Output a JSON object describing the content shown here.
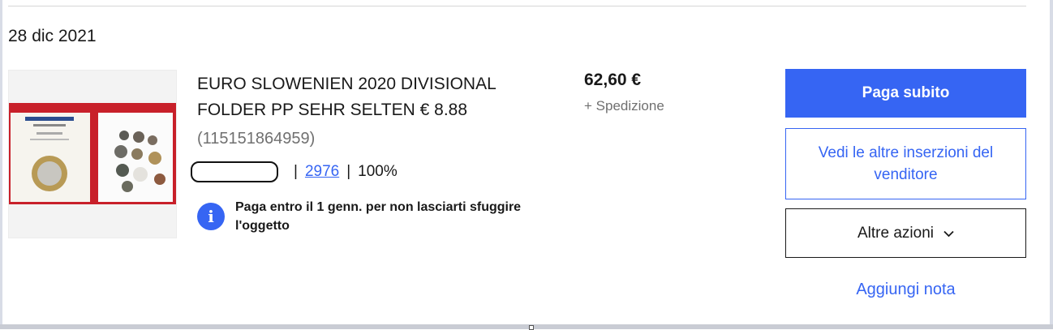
{
  "order": {
    "date": "28 dic 2021"
  },
  "item": {
    "title": "EURO SLOWENIEN 2020 DIVISIONAL FOLDER PP SEHR SELTEN € 8.88",
    "item_number": "(115151864959)",
    "seller": {
      "feedback_count": "2976",
      "feedback_percent": "100%",
      "separator": "|"
    },
    "notice": {
      "icon": "info-icon",
      "icon_glyph": "i",
      "text": "Paga entro il 1 genn. per non lasciarti sfuggire l'oggetto"
    }
  },
  "pricing": {
    "price": "62,60 €",
    "shipping": "+ Spedizione"
  },
  "actions": {
    "pay_now": "Paga subito",
    "view_seller_items": "Vedi le altre inserzioni del venditore",
    "more_actions": "Altre azioni",
    "more_actions_icon": "chevron-down-icon",
    "add_note": "Aggiungi nota"
  },
  "colors": {
    "accent": "#3665f3",
    "text": "#191919",
    "muted": "#707070"
  }
}
